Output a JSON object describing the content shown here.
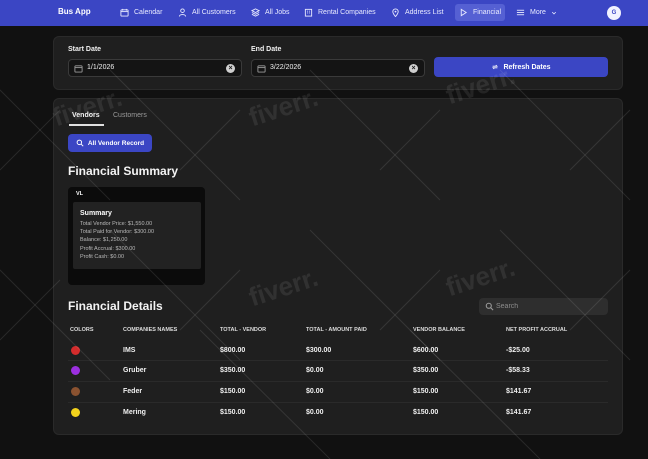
{
  "nav": {
    "brand": "Bus App",
    "items": [
      {
        "label": "Calendar",
        "icon": "calendar-icon"
      },
      {
        "label": "All Customers",
        "icon": "user-icon"
      },
      {
        "label": "All Jobs",
        "icon": "layers-icon"
      },
      {
        "label": "Rental Companies",
        "icon": "building-icon"
      },
      {
        "label": "Address List",
        "icon": "map-pin-icon"
      },
      {
        "label": "Financial",
        "icon": "play-icon"
      },
      {
        "label": "More",
        "icon": "menu-icon"
      }
    ],
    "active": "Financial",
    "avatar": "G"
  },
  "dates": {
    "start_label": "Start Date",
    "start_value": "1/1/2026",
    "end_label": "End Date",
    "end_value": "3/22/2026",
    "refresh_label": "Refresh Dates"
  },
  "tabs": [
    "Vendors",
    "Customers"
  ],
  "vendor_button": "All Vendor Record",
  "summary": {
    "heading": "Financial Summary",
    "card_tag": "VL",
    "title": "Summary",
    "lines": [
      "Total Vendor Price: $1,550.00",
      "Total Paid for Vendor: $300.00",
      "Balance: $1,250.00",
      "Profit Accrual: $300.00",
      "Profit Cash: $0.00"
    ]
  },
  "details": {
    "heading": "Financial Details",
    "search_placeholder": "Search",
    "columns": [
      "COLORS",
      "COMPANIES NAMES",
      "TOTAL - VENDOR",
      "TOTAL - AMOUNT PAID",
      "VENDOR BALANCE",
      "NET PROFIT ACCRUAL"
    ],
    "rows": [
      {
        "color": "#d42c2c",
        "name": "IMS",
        "total_vendor": "$800.00",
        "amount_paid": "$300.00",
        "balance": "$600.00",
        "net_profit": "-$25.00"
      },
      {
        "color": "#9b2fe0",
        "name": "Gruber",
        "total_vendor": "$350.00",
        "amount_paid": "$0.00",
        "balance": "$350.00",
        "net_profit": "-$58.33"
      },
      {
        "color": "#8a5230",
        "name": "Feder",
        "total_vendor": "$150.00",
        "amount_paid": "$0.00",
        "balance": "$150.00",
        "net_profit": "$141.67"
      },
      {
        "color": "#f2d21c",
        "name": "Mering",
        "total_vendor": "$150.00",
        "amount_paid": "$0.00",
        "balance": "$150.00",
        "net_profit": "$141.67"
      }
    ]
  },
  "colors": {
    "accent": "#3b46c4",
    "background": "#111111",
    "panel": "#1f1f1f"
  },
  "watermark": "fiverr."
}
